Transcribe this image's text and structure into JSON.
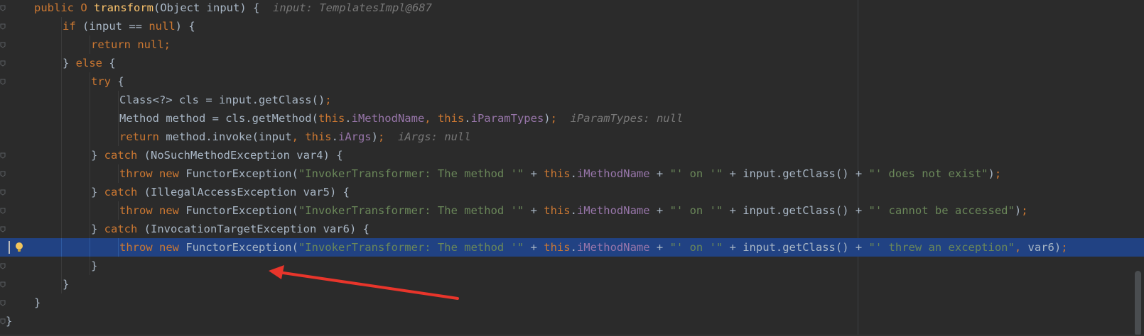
{
  "editor": {
    "lines": [
      {
        "segments": [
          {
            "t": "public ",
            "c": "kw"
          },
          {
            "t": "O ",
            "c": "kw"
          },
          {
            "t": "transform",
            "c": "fn"
          },
          {
            "t": "(Object input) {  ",
            "c": ""
          },
          {
            "t": "input: TemplatesImpl@687",
            "c": "hint"
          }
        ]
      },
      {
        "segments": [
          {
            "t": "if ",
            "c": "kw"
          },
          {
            "t": "(input == ",
            "c": ""
          },
          {
            "t": "null",
            "c": "kw"
          },
          {
            "t": ") {",
            "c": ""
          }
        ]
      },
      {
        "segments": [
          {
            "t": "return null",
            "c": "kw"
          },
          {
            "t": ";",
            "c": "kw"
          }
        ]
      },
      {
        "segments": [
          {
            "t": "} ",
            "c": ""
          },
          {
            "t": "else ",
            "c": "kw"
          },
          {
            "t": "{",
            "c": ""
          }
        ]
      },
      {
        "segments": [
          {
            "t": "try ",
            "c": "kw"
          },
          {
            "t": "{",
            "c": ""
          }
        ]
      },
      {
        "segments": [
          {
            "t": "Class<?> cls = input.getClass()",
            "c": ""
          },
          {
            "t": ";",
            "c": "kw"
          }
        ]
      },
      {
        "segments": [
          {
            "t": "Method method = cls.getMethod(",
            "c": ""
          },
          {
            "t": "this",
            "c": "kw"
          },
          {
            "t": ".",
            "c": ""
          },
          {
            "t": "iMethodName",
            "c": "fld"
          },
          {
            "t": ", ",
            "c": "kw"
          },
          {
            "t": "this",
            "c": "kw"
          },
          {
            "t": ".",
            "c": ""
          },
          {
            "t": "iParamTypes",
            "c": "fld"
          },
          {
            "t": ")",
            "c": ""
          },
          {
            "t": ";  ",
            "c": "kw"
          },
          {
            "t": "iParamTypes: null",
            "c": "hint"
          }
        ]
      },
      {
        "segments": [
          {
            "t": "return ",
            "c": "kw"
          },
          {
            "t": "method.invoke(input",
            "c": ""
          },
          {
            "t": ", ",
            "c": "kw"
          },
          {
            "t": "this",
            "c": "kw"
          },
          {
            "t": ".",
            "c": ""
          },
          {
            "t": "iArgs",
            "c": "fld"
          },
          {
            "t": ")",
            "c": ""
          },
          {
            "t": ";  ",
            "c": "kw"
          },
          {
            "t": "iArgs: null",
            "c": "hint"
          }
        ]
      },
      {
        "segments": [
          {
            "t": "} ",
            "c": ""
          },
          {
            "t": "catch ",
            "c": "kw"
          },
          {
            "t": "(NoSuchMethodException var4) {",
            "c": ""
          }
        ]
      },
      {
        "segments": [
          {
            "t": "throw new ",
            "c": "kw"
          },
          {
            "t": "FunctorException(",
            "c": ""
          },
          {
            "t": "\"InvokerTransformer: The method '\"",
            "c": "str"
          },
          {
            "t": " + ",
            "c": ""
          },
          {
            "t": "this",
            "c": "kw"
          },
          {
            "t": ".",
            "c": ""
          },
          {
            "t": "iMethodName",
            "c": "fld"
          },
          {
            "t": " + ",
            "c": ""
          },
          {
            "t": "\"' on '\"",
            "c": "str"
          },
          {
            "t": " + input.getClass() + ",
            "c": ""
          },
          {
            "t": "\"' does not exist\"",
            "c": "str"
          },
          {
            "t": ")",
            "c": ""
          },
          {
            "t": ";",
            "c": "kw"
          }
        ]
      },
      {
        "segments": [
          {
            "t": "} ",
            "c": ""
          },
          {
            "t": "catch ",
            "c": "kw"
          },
          {
            "t": "(IllegalAccessException var5) {",
            "c": ""
          }
        ]
      },
      {
        "segments": [
          {
            "t": "throw new ",
            "c": "kw"
          },
          {
            "t": "FunctorException(",
            "c": ""
          },
          {
            "t": "\"InvokerTransformer: The method '\"",
            "c": "str"
          },
          {
            "t": " + ",
            "c": ""
          },
          {
            "t": "this",
            "c": "kw"
          },
          {
            "t": ".",
            "c": ""
          },
          {
            "t": "iMethodName",
            "c": "fld"
          },
          {
            "t": " + ",
            "c": ""
          },
          {
            "t": "\"' on '\"",
            "c": "str"
          },
          {
            "t": " + input.getClass() + ",
            "c": ""
          },
          {
            "t": "\"' cannot be accessed\"",
            "c": "str"
          },
          {
            "t": ")",
            "c": ""
          },
          {
            "t": ";",
            "c": "kw"
          }
        ]
      },
      {
        "segments": [
          {
            "t": "} ",
            "c": ""
          },
          {
            "t": "catch ",
            "c": "kw"
          },
          {
            "t": "(InvocationTargetException var6) {",
            "c": ""
          }
        ]
      },
      {
        "segments": [
          {
            "t": "throw new ",
            "c": "kw"
          },
          {
            "t": "FunctorException(",
            "c": ""
          },
          {
            "t": "\"InvokerTransformer: The method '\"",
            "c": "str"
          },
          {
            "t": " + ",
            "c": ""
          },
          {
            "t": "this",
            "c": "kw"
          },
          {
            "t": ".",
            "c": ""
          },
          {
            "t": "iMethodName",
            "c": "fld"
          },
          {
            "t": " + ",
            "c": ""
          },
          {
            "t": "\"' on '\"",
            "c": "str"
          },
          {
            "t": " + input.getClass() + ",
            "c": ""
          },
          {
            "t": "\"' threw an exception\"",
            "c": "str"
          },
          {
            "t": ", ",
            "c": "kw"
          },
          {
            "t": "var6)",
            "c": ""
          },
          {
            "t": ";",
            "c": "kw"
          }
        ]
      },
      {
        "segments": [
          {
            "t": "}",
            "c": ""
          }
        ]
      },
      {
        "segments": [
          {
            "t": "}",
            "c": ""
          }
        ]
      },
      {
        "segments": [
          {
            "t": "}",
            "c": ""
          }
        ]
      },
      {
        "segments": [
          {
            "t": "}",
            "c": ""
          }
        ]
      }
    ],
    "current_line": 13,
    "intention_icon": "lightbulb-icon",
    "annotation_arrow_color": "#e8352b"
  }
}
